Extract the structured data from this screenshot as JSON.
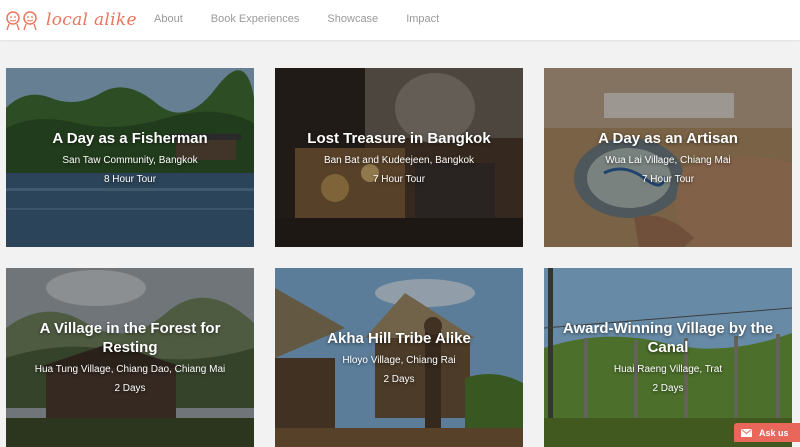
{
  "brand": {
    "name": "local alike"
  },
  "nav": [
    "About",
    "Book Experiences",
    "Showcase",
    "Impact"
  ],
  "tours": [
    {
      "title": "A Day as a Fisherman",
      "place": "San Taw Community, Bangkok",
      "duration": "8 Hour Tour"
    },
    {
      "title": "Lost Treasure in Bangkok",
      "place": "Ban Bat and Kudeejeen, Bangkok",
      "duration": "7 Hour Tour"
    },
    {
      "title": "A Day as an Artisan",
      "place": "Wua Lai Village, Chiang Mai",
      "duration": "7 Hour Tour"
    },
    {
      "title": "A Village in the Forest for Resting",
      "place": "Hua Tung Village, Chiang Dao, Chiang Mai",
      "duration": "2 Days"
    },
    {
      "title": "Akha Hill Tribe Alike",
      "place": "Hloyo Village, Chiang Rai",
      "duration": "2 Days"
    },
    {
      "title": "Award-Winning Village by the Canal",
      "place": "Huai Raeng Village, Trat",
      "duration": "2 Days"
    }
  ],
  "chat": {
    "label": "Ask us",
    "icon": "mail-icon"
  },
  "colors": {
    "brand": "#e8765f",
    "nav_text": "#9a9a9a",
    "chat_bg": "#e8665a"
  }
}
